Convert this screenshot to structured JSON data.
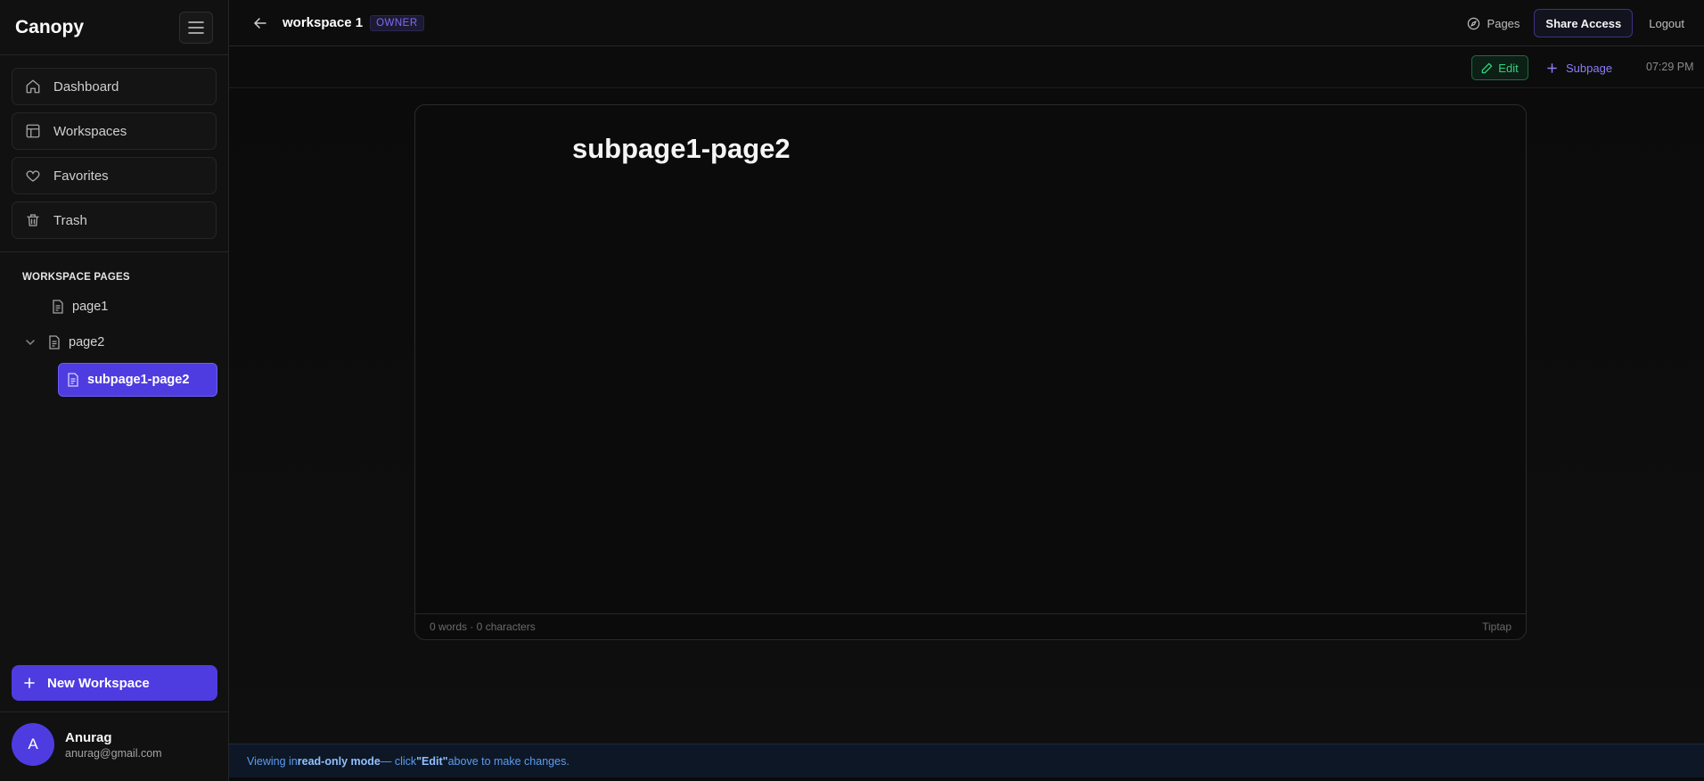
{
  "sidebar": {
    "brand": "Canopy",
    "nav": [
      {
        "label": "Dashboard",
        "icon": "home-icon"
      },
      {
        "label": "Workspaces",
        "icon": "layout-icon"
      },
      {
        "label": "Favorites",
        "icon": "heart-icon"
      },
      {
        "label": "Trash",
        "icon": "trash-icon"
      }
    ],
    "section_title": "WORKSPACE PAGES",
    "pages": [
      {
        "label": "page1"
      },
      {
        "label": "page2"
      },
      {
        "label": "subpage1-page2"
      }
    ],
    "new_workspace_label": "New Workspace",
    "user": {
      "initial": "A",
      "name": "Anurag",
      "email": "anurag@gmail.com"
    }
  },
  "topbar": {
    "workspace_title": "workspace 1",
    "role_badge": "OWNER",
    "pages_label": "Pages",
    "share_label": "Share Access",
    "logout_label": "Logout"
  },
  "toolbar": {
    "edit_label": "Edit",
    "subpage_label": "Subpage",
    "time": "07:29 PM"
  },
  "editor": {
    "title": "subpage1-page2",
    "stats": "0 words · 0 characters",
    "engine": "Tiptap"
  },
  "banner": {
    "prefix": "Viewing in ",
    "mode": "read-only mode",
    "middle": " — click ",
    "action": "\"Edit\"",
    "suffix": " above to make changes."
  },
  "colors": {
    "accent": "#4f3ce0",
    "edit_green": "#34d27b",
    "banner_blue": "#5b9cf0"
  }
}
